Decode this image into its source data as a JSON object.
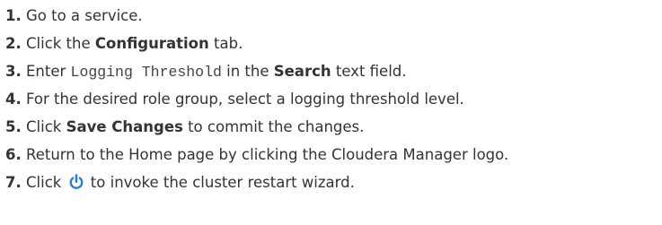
{
  "steps": [
    {
      "number": "1.",
      "parts": {
        "a": "Go to a service."
      }
    },
    {
      "number": "2.",
      "parts": {
        "a": "Click the ",
        "b": "Configuration",
        "c": " tab."
      }
    },
    {
      "number": "3.",
      "parts": {
        "a": "Enter ",
        "code": "Logging Threshold",
        "b": " in the ",
        "c": "Search",
        "d": " text field."
      }
    },
    {
      "number": "4.",
      "parts": {
        "a": "For the desired role group, select a logging threshold level."
      }
    },
    {
      "number": "5.",
      "parts": {
        "a": "Click ",
        "b": "Save Changes",
        "c": " to commit the changes."
      }
    },
    {
      "number": "6.",
      "parts": {
        "a": "Return to the Home page by clicking the Cloudera Manager logo."
      }
    },
    {
      "number": "7.",
      "parts": {
        "a": "Click ",
        "icon": "restart-icon",
        "b": " to invoke the cluster restart wizard."
      }
    }
  ],
  "colors": {
    "text": "#333333",
    "icon": "#2a7fc9"
  }
}
